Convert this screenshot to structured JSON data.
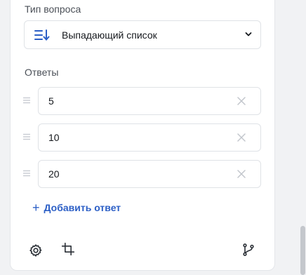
{
  "question_type": {
    "label": "Тип вопроса",
    "selected": "Выпадающий список",
    "icon": "dropdown-list-icon"
  },
  "answers": {
    "label": "Ответы",
    "items": [
      {
        "value": "5"
      },
      {
        "value": "10"
      },
      {
        "value": "20"
      }
    ],
    "add_label": "Добавить ответ"
  },
  "toolbar": {
    "icons": [
      "gear-icon",
      "crop-icon",
      "branch-icon"
    ]
  },
  "colors": {
    "accent": "#2c5fc6",
    "text": "#15181d",
    "muted": "#4a4f57",
    "border": "#dfe2e6"
  }
}
